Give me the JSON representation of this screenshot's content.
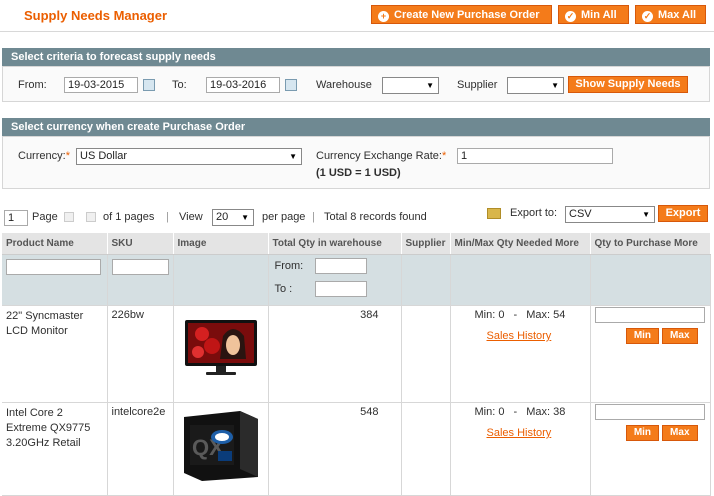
{
  "header": {
    "title": "Supply Needs Manager",
    "create_po_label": "Create New Purchase Order",
    "min_all_label": "Min All",
    "max_all_label": "Max All"
  },
  "criteria": {
    "section_title": "Select criteria to forecast supply needs",
    "from_label": "From:",
    "from_value": "19-03-2015",
    "to_label": "To:",
    "to_value": "19-03-2016",
    "warehouse_label": "Warehouse",
    "warehouse_value": "",
    "supplier_label": "Supplier",
    "supplier_value": "",
    "show_button": "Show Supply Needs"
  },
  "currency": {
    "section_title": "Select currency when create Purchase Order",
    "currency_label": "Currency:",
    "currency_value": "US Dollar",
    "rate_label": "Currency Exchange Rate:",
    "rate_value": "1",
    "rate_note": "(1 USD = 1 USD)"
  },
  "pager": {
    "page_value": "1",
    "page_label": "Page",
    "of_pages": "of 1 pages",
    "view_label": "View",
    "per_page_value": "20",
    "per_page_label": "per page",
    "total": "Total 8 records found",
    "export_label": "Export to:",
    "export_value": "CSV",
    "export_button": "Export"
  },
  "grid": {
    "columns": [
      "Product Name",
      "SKU",
      "Image",
      "Total Qty in warehouse",
      "Supplier",
      "Min/Max Qty Needed More",
      "Qty to Purchase More"
    ],
    "filter_from": "From:",
    "filter_to": "To :",
    "rows": [
      {
        "name": "22\" Syncmaster LCD Monitor",
        "sku": "226bw",
        "qty": "384",
        "supplier": "",
        "min": "Min: 0",
        "sep": "-",
        "max": "Max: 54",
        "history": "Sales History",
        "min_btn": "Min",
        "max_btn": "Max"
      },
      {
        "name": "Intel Core 2 Extreme QX9775 3.20GHz Retail",
        "sku": "intelcore2e",
        "qty": "548",
        "supplier": "",
        "min": "Min: 0",
        "sep": "-",
        "max": "Max: 38",
        "history": "Sales History",
        "min_btn": "Min",
        "max_btn": "Max"
      }
    ]
  },
  "colors": {
    "accent": "#f47b1a",
    "section_bar": "#6f8992",
    "title": "#eb5e00"
  }
}
